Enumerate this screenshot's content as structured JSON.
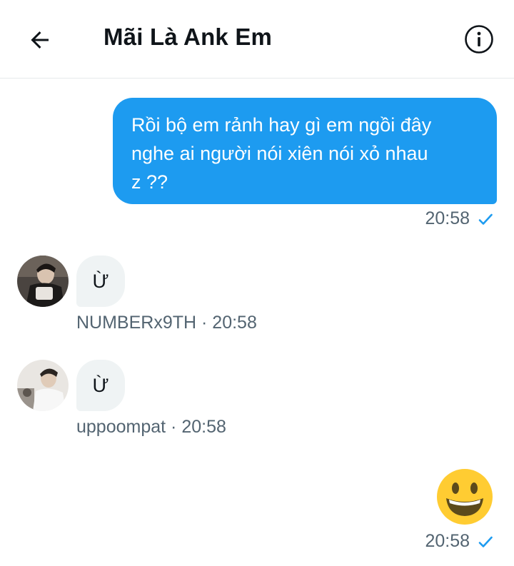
{
  "header": {
    "title": "Mãi Là Ank Em",
    "back_icon": "arrow-left-icon",
    "info_icon": "info-circle-icon"
  },
  "messages": [
    {
      "direction": "outgoing",
      "lines": [
        "Rồi bộ em rảnh hay gì em ngồi đây",
        "nghe ai người nói xiên nói xỏ nhau",
        "z ??"
      ],
      "time": "20:58",
      "status_icon": "check-icon"
    },
    {
      "direction": "incoming",
      "text": "Ừ",
      "sender": "NUMBERx9TH",
      "separator": " · ",
      "time": "20:58"
    },
    {
      "direction": "incoming",
      "text": "Ừ",
      "sender": "uppoompat",
      "separator": " · ",
      "time": "20:58"
    },
    {
      "direction": "outgoing",
      "emoji": "grinning-face-emoji",
      "time": "20:58",
      "status_icon": "check-icon"
    }
  ],
  "colors": {
    "accent": "#1d9bf0",
    "incoming_bubble": "#eff3f4",
    "secondary_text": "#536471"
  }
}
